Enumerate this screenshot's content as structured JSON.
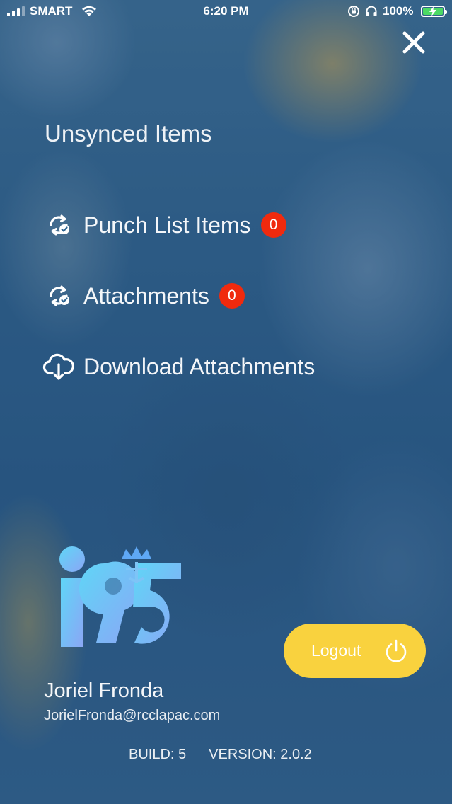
{
  "status_bar": {
    "carrier": "SMART",
    "time": "6:20 PM",
    "battery_percent": "100%",
    "battery_color": "#4cd964"
  },
  "menu": {
    "title": "Unsynced Items",
    "items": [
      {
        "label": "Punch List Items",
        "count": "0",
        "icon": "sync-check-icon"
      },
      {
        "label": "Attachments",
        "count": "0",
        "icon": "sync-check-icon"
      },
      {
        "label": "Download Attachments",
        "icon": "cloud-download-icon"
      }
    ]
  },
  "user": {
    "name": "Joriel Fronda",
    "email": "JorielFronda@rcclapac.com"
  },
  "logout": {
    "label": "Logout"
  },
  "footer": {
    "build": "BUILD: 5",
    "version": "VERSION: 2.0.2"
  },
  "colors": {
    "badge": "#f02a0e",
    "logout_button": "#f9d23e",
    "logo_gradient_start": "#5fd6f7",
    "logo_gradient_end": "#8ba6f5"
  },
  "logo": {
    "text": "i95"
  }
}
